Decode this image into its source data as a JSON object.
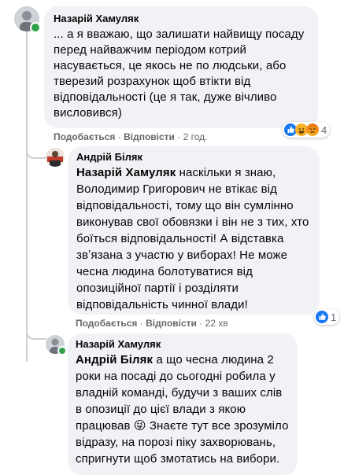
{
  "comments": [
    {
      "author": "Назарій Хамуляк",
      "text": "... а я вважаю, що залишати найвищу посаду перед найважчим періодом котрий насувається, це якось не по людськи, або тверезий розрахунок щоб втікти від відповідальності (це я так, дуже вічливо висловився)",
      "like_label": "Подобається",
      "reply_label": "Відповісти",
      "time": "2 год.",
      "reactions": {
        "icons": [
          "like-icon",
          "haha-icon",
          "angry-icon"
        ],
        "count": "4"
      }
    },
    {
      "author": "Андрій Біляк",
      "mention": "Назарій Хамуляк",
      "text": " наскільки я знаю, Володимир Григорович не втікає від відповідальності, тому що він сумлінно виконував свої обовязки і він не з тих, хто боїться відповідальності! А відставка звʼязана з участю у виборах! Не може чесна людина болотуватися від опозиційної партії і розділяти відповідальність чинної влади!",
      "like_label": "Подобається",
      "reply_label": "Відповісти",
      "time": "22 хв",
      "reactions": {
        "icons": [
          "like-icon"
        ],
        "count": "1"
      }
    },
    {
      "author": "Назарій Хамуляк",
      "mention": "Андрій Біляк",
      "text": " а що чесна людина 2 роки на посаді до сьогодні робила у владній команді, будучи з ваших слів в опозиції до цієї влади з якою працював 😜 Знаєте тут все зрозуміло відразу, на порозі піку захворювань, спригнути щоб змотатись на вибори."
    }
  ],
  "colors": {
    "bubble": "#f0f2f5",
    "meta": "#65676b",
    "like_blue": "#1877f2",
    "online": "#31a24c"
  }
}
